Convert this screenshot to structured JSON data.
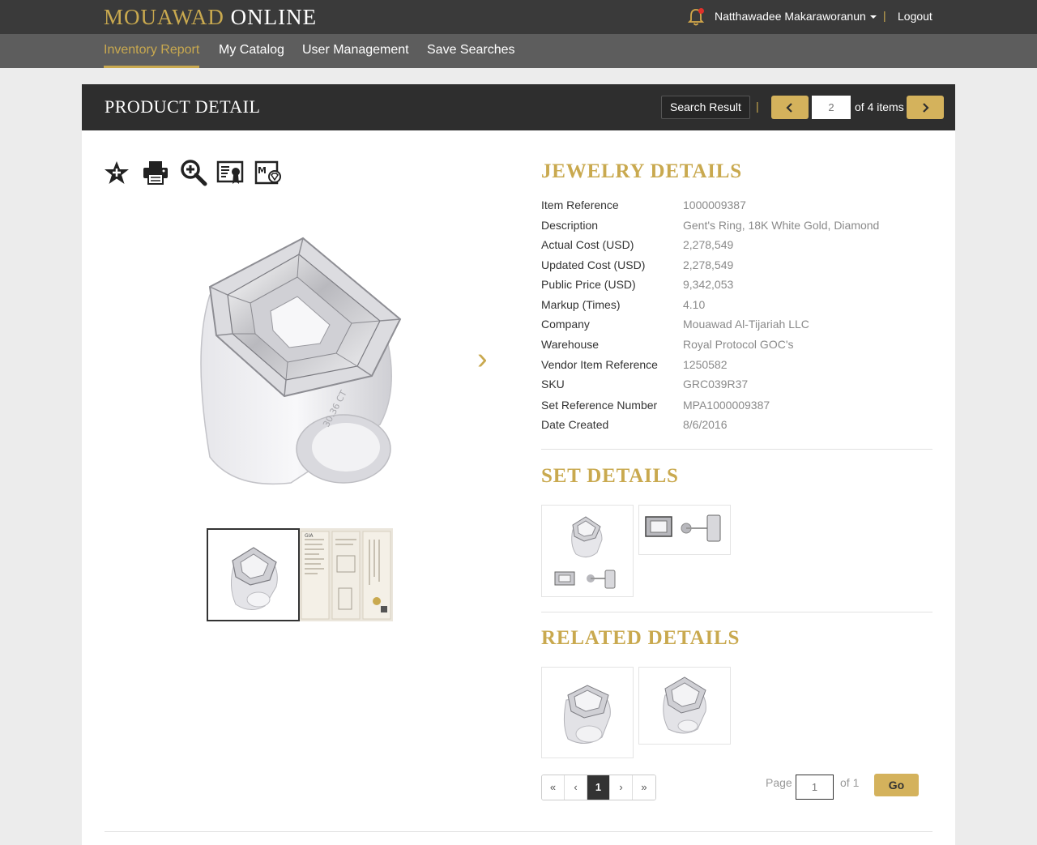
{
  "app": {
    "logo_brand": "MOUAWAD",
    "logo_suffix": " ONLINE",
    "username": "Natthawadee Makaraworanun",
    "separator": "|",
    "logout_label": "Logout"
  },
  "nav": {
    "items": [
      {
        "label": "Inventory Report",
        "active": true
      },
      {
        "label": "My Catalog",
        "active": false
      },
      {
        "label": "User Management",
        "active": false
      },
      {
        "label": "Save Searches",
        "active": false
      }
    ]
  },
  "header": {
    "title": "PRODUCT DETAIL",
    "search_result_label": "Search Result",
    "separator": "|",
    "current_item": "2",
    "of_items": "of 4 items",
    "prev_icon": "chevron-left-icon",
    "next_icon": "chevron-right-icon"
  },
  "tools": [
    "favorite-star-icon",
    "print-icon",
    "zoom-in-icon",
    "certificate-icon",
    "catalog-icon"
  ],
  "image": {
    "next_arrow": "›",
    "engraving": "30.36 CT"
  },
  "jewelry": {
    "title": "JEWELRY DETAILS",
    "rows": [
      {
        "label": "Item Reference",
        "value": "1000009387"
      },
      {
        "label": "Description",
        "value": "Gent's Ring, 18K White Gold, Diamond"
      },
      {
        "label": "Actual Cost (USD)",
        "value": "2,278,549"
      },
      {
        "label": "Updated Cost (USD)",
        "value": "2,278,549"
      },
      {
        "label": "Public Price (USD)",
        "value": "9,342,053"
      },
      {
        "label": "Markup (Times)",
        "value": "4.10"
      },
      {
        "label": "Company",
        "value": "Mouawad Al-Tijariah LLC"
      },
      {
        "label": "Warehouse",
        "value": "Royal Protocol GOC's"
      },
      {
        "label": "Vendor Item Reference",
        "value": "1250582"
      },
      {
        "label": "SKU",
        "value": "GRC039R37"
      },
      {
        "label": "Set Reference Number",
        "value": "MPA1000009387"
      },
      {
        "label": "Date Created",
        "value": "8/6/2016"
      }
    ]
  },
  "set_details": {
    "title": "SET DETAILS"
  },
  "related": {
    "title": "RELATED DETAILS"
  },
  "pagination": {
    "first": "«",
    "prev": "‹",
    "current": "1",
    "next": "›",
    "last": "»",
    "page_label": "Page",
    "page_value": "1",
    "of_label": "of  1",
    "go_label": "Go"
  },
  "colors": {
    "accent_gold": "#c9a94f",
    "button_gold": "#d4b25c",
    "header_dark": "#2e2e2e",
    "notification_red": "#e0302a"
  }
}
